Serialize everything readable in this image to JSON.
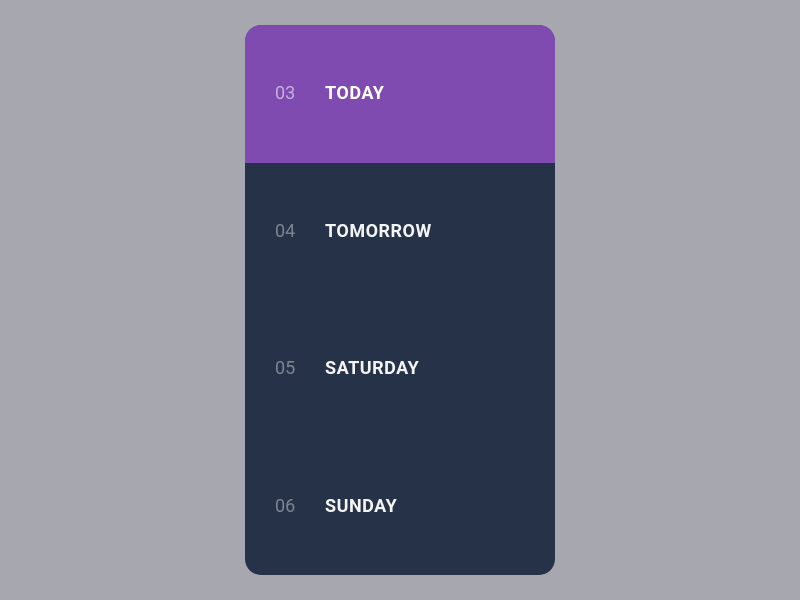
{
  "days": [
    {
      "num": "03",
      "label": "TODAY",
      "active": true
    },
    {
      "num": "04",
      "label": "TOMORROW",
      "active": false
    },
    {
      "num": "05",
      "label": "SATURDAY",
      "active": false
    },
    {
      "num": "06",
      "label": "SUNDAY",
      "active": false
    }
  ],
  "colors": {
    "background": "#a7a7b0",
    "card": "#263248",
    "accent": "#7f4bb0"
  }
}
